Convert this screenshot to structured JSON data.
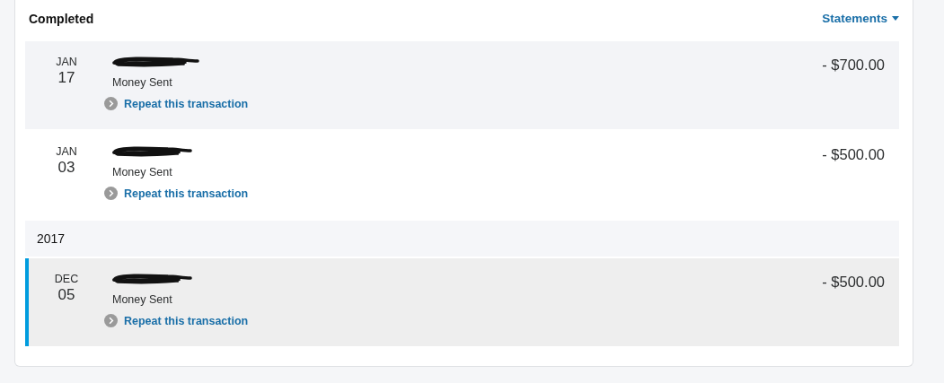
{
  "section": {
    "title": "Completed",
    "statements_link": "Statements"
  },
  "entries": [
    {
      "kind": "transaction",
      "month": "JAN",
      "day": "17",
      "type": "Money Sent",
      "action": "Repeat this transaction",
      "amount": "- $700.00",
      "shaded": true,
      "selected": false
    },
    {
      "kind": "transaction",
      "month": "JAN",
      "day": "03",
      "type": "Money Sent",
      "action": "Repeat this transaction",
      "amount": "- $500.00",
      "selected": false
    },
    {
      "kind": "year",
      "label": "2017"
    },
    {
      "kind": "transaction",
      "month": "DEC",
      "day": "05",
      "type": "Money Sent",
      "action": "Repeat this transaction",
      "amount": "- $500.00",
      "selected": true
    }
  ]
}
